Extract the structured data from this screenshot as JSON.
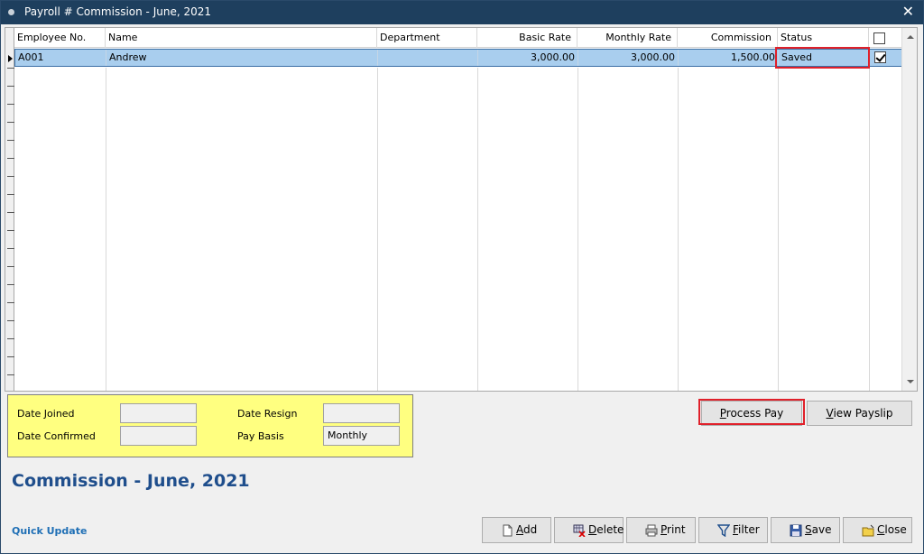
{
  "window": {
    "title": "Payroll # Commission - June, 2021",
    "close_glyph": "✕"
  },
  "grid": {
    "columns": [
      "Employee No.",
      "Name",
      "Department",
      "Basic Rate",
      "Monthly Rate",
      "Commission",
      "Status"
    ],
    "rows": [
      {
        "employee_no": "A001",
        "name": "Andrew",
        "department": "",
        "basic_rate": "3,000.00",
        "monthly_rate": "3,000.00",
        "commission": "1,500.00",
        "status": "Saved",
        "checked": true
      }
    ],
    "header_checkbox_checked": false
  },
  "info": {
    "date_joined_label": "Date Joined",
    "date_joined_value": "",
    "date_confirmed_label": "Date Confirmed",
    "date_confirmed_value": "",
    "date_resign_label": "Date Resign",
    "date_resign_value": "",
    "pay_basis_label": "Pay Basis",
    "pay_basis_value": "Monthly"
  },
  "actions": {
    "process_pay": {
      "pre": "",
      "u": "P",
      "post": "rocess Pay"
    },
    "view_payslip": {
      "pre": "",
      "u": "V",
      "post": "iew Payslip"
    }
  },
  "heading": "Commission - June, 2021",
  "quick_update": "Quick Update",
  "toolbar": {
    "add": {
      "u": "A",
      "post": "dd"
    },
    "delete": {
      "u": "D",
      "post": "elete"
    },
    "print": {
      "u": "P",
      "post": "rint"
    },
    "filter": {
      "u": "F",
      "post": "ilter"
    },
    "save": {
      "u": "S",
      "post": "ave"
    },
    "close": {
      "u": "C",
      "post": "lose"
    }
  },
  "colors": {
    "title_bar": "#1e3f5e",
    "selection": "#a9ceee",
    "highlight": "#e0202a",
    "info_panel": "#ffff80",
    "heading": "#1f4e8c"
  }
}
